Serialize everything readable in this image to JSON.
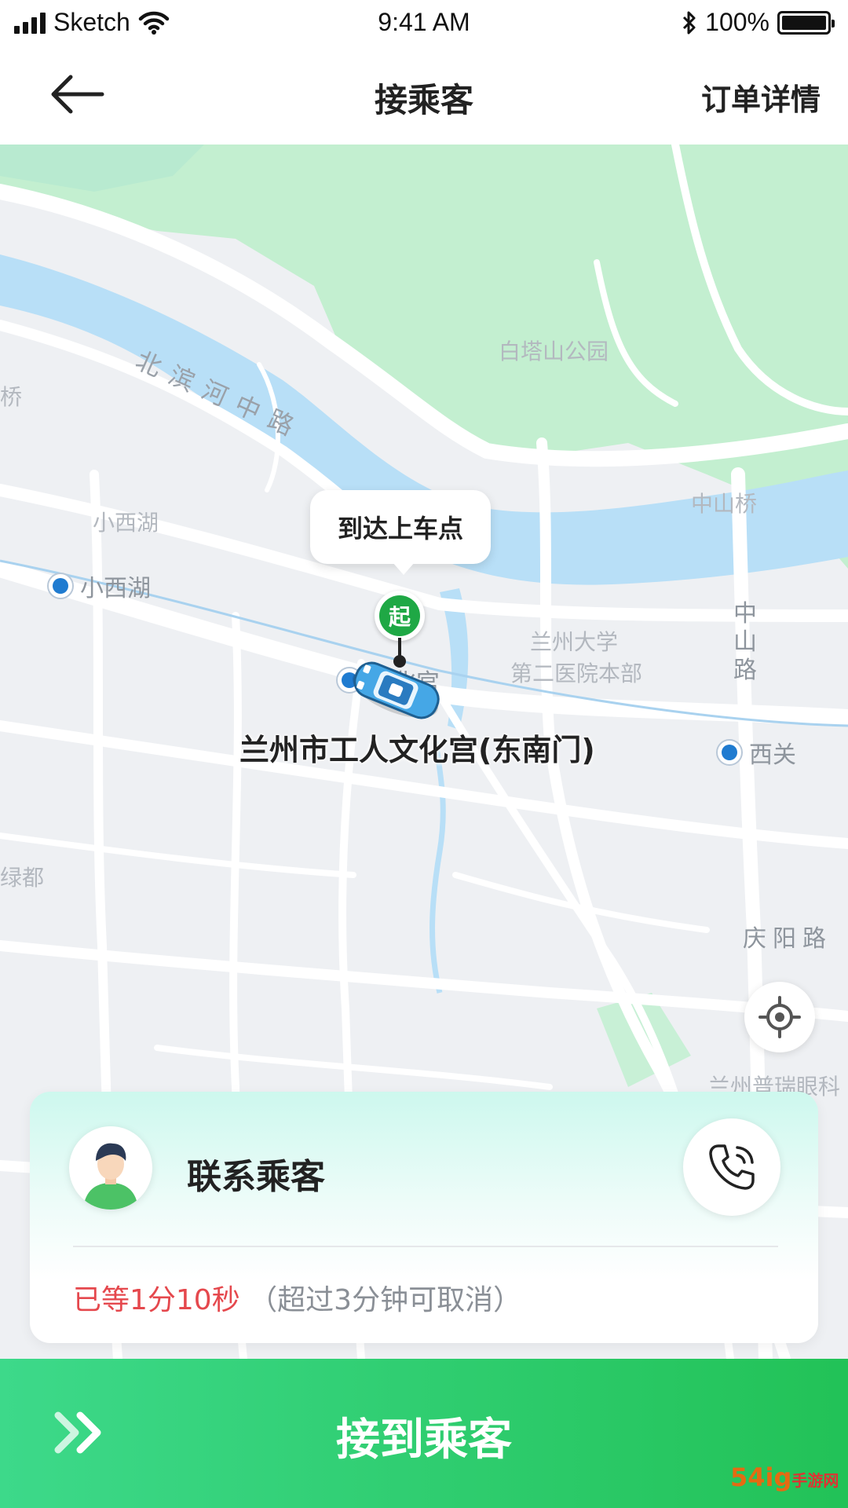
{
  "status_bar": {
    "carrier": "Sketch",
    "time": "9:41 AM",
    "battery": "100%",
    "battery_level": 1.0
  },
  "nav": {
    "title": "接乘客",
    "order_detail": "订单详情"
  },
  "map": {
    "labels": {
      "park": "白塔山公园",
      "road_beibinhe": "北滨河中路",
      "bridge_left": "桥",
      "xixihu": "小西湖",
      "zhongshan_bridge": "中山桥",
      "zhongshan_road": "中山路",
      "hospital_line1": "兰州大学",
      "hospital_line2": "第二医院本部",
      "lvdu": "绿都",
      "qingyang_road": "庆阳路",
      "eye_hospital": "兰州普瑞眼科"
    },
    "metro_xixihu": "小西湖",
    "metro_xiguan": "西关",
    "metro_culture": "化宫",
    "pickup_bubble": "到达上车点",
    "start_marker": "起",
    "place_name": "兰州市工人文化宫(东南门)"
  },
  "card": {
    "contact_label": "联系乘客",
    "wait_elapsed": "已等1分10秒",
    "wait_note": "（超过3分钟可取消）"
  },
  "action": {
    "label": "接到乘客"
  },
  "watermark": {
    "text": "54ig",
    "sub": "手游网"
  },
  "colors": {
    "accent_green": "#22c257",
    "warning_red": "#e5484d",
    "river": "#b8dff7",
    "park": "#c3efd0"
  }
}
